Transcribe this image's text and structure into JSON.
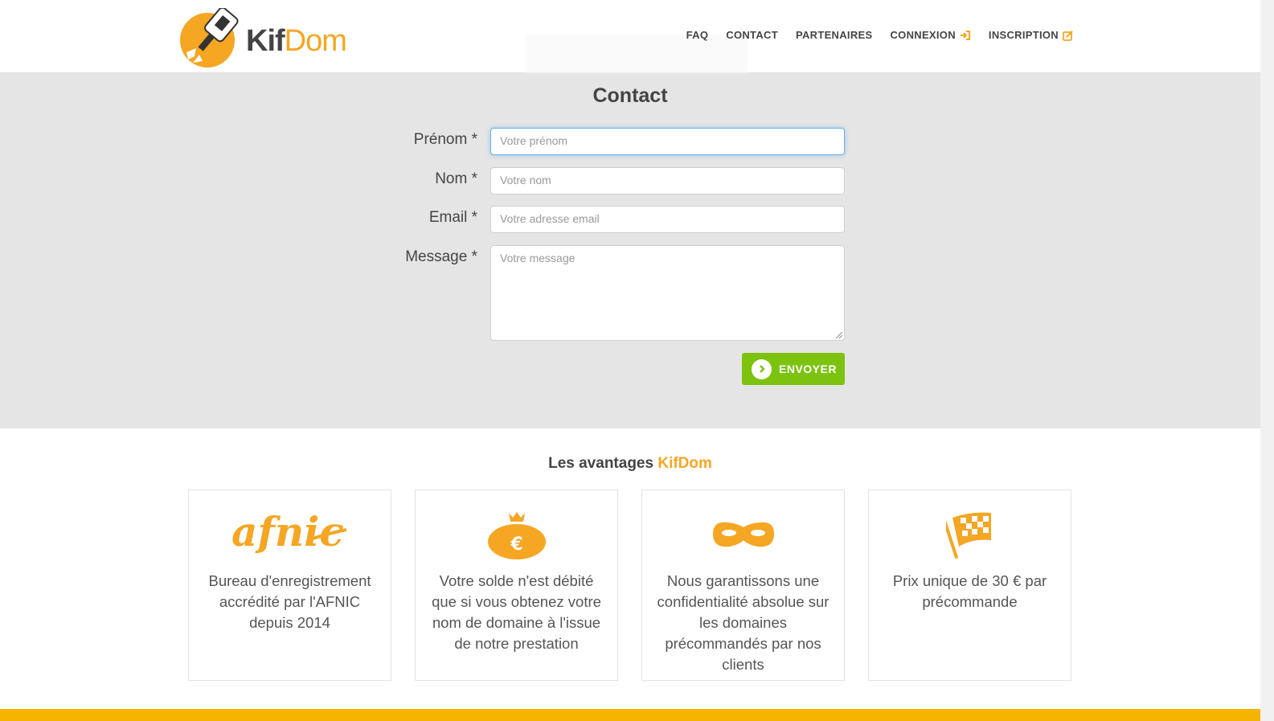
{
  "brand": {
    "name_part1": "Kif",
    "name_part2": "Dom",
    "accent_color": "#f5a623",
    "green_color": "#7dc20f"
  },
  "nav": {
    "items": [
      {
        "label": "FAQ",
        "icon": ""
      },
      {
        "label": "CONTACT",
        "icon": ""
      },
      {
        "label": "PARTENAIRES",
        "icon": ""
      },
      {
        "label": "CONNEXION",
        "icon": "sign-in-icon"
      },
      {
        "label": "INSCRIPTION",
        "icon": "edit-icon"
      }
    ]
  },
  "contact": {
    "title": "Contact",
    "fields": {
      "prenom": {
        "label": "Prénom *",
        "placeholder": "Votre prénom"
      },
      "nom": {
        "label": "Nom *",
        "placeholder": "Votre nom"
      },
      "email": {
        "label": "Email *",
        "placeholder": "Votre adresse email"
      },
      "message": {
        "label": "Message *",
        "placeholder": "Votre message"
      }
    },
    "submit_label": "ENVOYER"
  },
  "advantages": {
    "title_prefix": "Les avantages",
    "title_brand": "KifDom",
    "cards": [
      {
        "icon": "afnic-logo",
        "logo_text": "afnic",
        "text": "Bureau d'enregistrement accrédité par l'AFNIC depuis 2014"
      },
      {
        "icon": "money-bag-euro-icon",
        "text": "Votre solde n'est débité que si vous obtenez votre nom de domaine à l'issue de notre prestation"
      },
      {
        "icon": "mask-icon",
        "text": "Nous garantissons une confidentialité absolue sur les domaines précommandés par nos clients"
      },
      {
        "icon": "checkered-flag-icon",
        "text": "Prix unique de 30 € par précommande"
      }
    ]
  }
}
